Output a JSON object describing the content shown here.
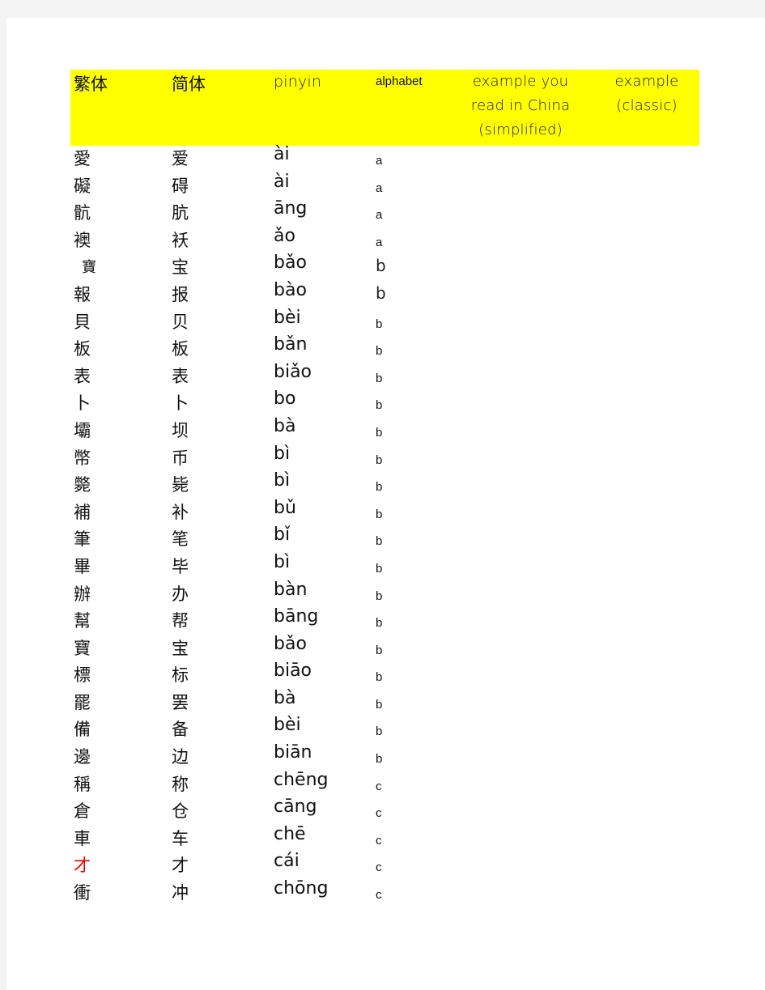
{
  "header": {
    "traditional": "繁体",
    "simplified": "简体",
    "pinyin": "pinyin",
    "alphabet": "alphabet",
    "example_china_line1": "example you",
    "example_china_line2": "read in China",
    "example_china_line3": "(simplified)",
    "example_classic_line1": "example",
    "example_classic_line2": "(classic)"
  },
  "colors": {
    "header_bg": "#ffff00",
    "highlight_text": "#e00000",
    "page_bg": "#ffffff",
    "surround_bg": "#f3f3f3"
  },
  "rows": [
    {
      "traditional": "愛",
      "simplified": "爱",
      "pinyin": "ài",
      "alphabet": "a"
    },
    {
      "traditional": "礙",
      "simplified": "碍",
      "pinyin": "ài",
      "alphabet": "a"
    },
    {
      "traditional": "骯",
      "simplified": "肮",
      "pinyin": "āng",
      "alphabet": "a"
    },
    {
      "traditional": "襖",
      "simplified": "袄",
      "pinyin": "ǎo",
      "alphabet": "a"
    },
    {
      "traditional": "寶",
      "simplified": "宝",
      "pinyin": "bǎo",
      "alphabet": "b"
    },
    {
      "traditional": "報",
      "simplified": "报",
      "pinyin": "bào",
      "alphabet": "b"
    },
    {
      "traditional": "貝",
      "simplified": "贝",
      "pinyin": "bèi",
      "alphabet": "b"
    },
    {
      "traditional": "板",
      "simplified": "板",
      "pinyin": "bǎn",
      "alphabet": "b"
    },
    {
      "traditional": "表",
      "simplified": "表",
      "pinyin": "biǎo",
      "alphabet": "b"
    },
    {
      "traditional": "卜",
      "simplified": "卜",
      "pinyin": "bo",
      "alphabet": "b"
    },
    {
      "traditional": "壩",
      "simplified": "坝",
      "pinyin": "bà",
      "alphabet": "b"
    },
    {
      "traditional": "幣",
      "simplified": "币",
      "pinyin": "bì",
      "alphabet": "b"
    },
    {
      "traditional": "斃",
      "simplified": "毙",
      "pinyin": "bì",
      "alphabet": "b"
    },
    {
      "traditional": "補",
      "simplified": "补",
      "pinyin": "bǔ",
      "alphabet": "b"
    },
    {
      "traditional": "筆",
      "simplified": "笔",
      "pinyin": "bǐ",
      "alphabet": "b"
    },
    {
      "traditional": "畢",
      "simplified": "毕",
      "pinyin": "bì",
      "alphabet": "b"
    },
    {
      "traditional": "辦",
      "simplified": "办",
      "pinyin": "bàn",
      "alphabet": "b"
    },
    {
      "traditional": "幫",
      "simplified": "帮",
      "pinyin": "bāng",
      "alphabet": "b"
    },
    {
      "traditional": "寶",
      "simplified": "宝",
      "pinyin": "bǎo",
      "alphabet": "b"
    },
    {
      "traditional": "標",
      "simplified": "标",
      "pinyin": "biāo",
      "alphabet": "b"
    },
    {
      "traditional": "罷",
      "simplified": "罢",
      "pinyin": "bà",
      "alphabet": "b"
    },
    {
      "traditional": "備",
      "simplified": "备",
      "pinyin": "bèi",
      "alphabet": "b"
    },
    {
      "traditional": "邊",
      "simplified": "边",
      "pinyin": "biān",
      "alphabet": "b"
    },
    {
      "traditional": "稱",
      "simplified": "称",
      "pinyin": "chēng",
      "alphabet": "c"
    },
    {
      "traditional": "倉",
      "simplified": "仓",
      "pinyin": "cāng",
      "alphabet": "c"
    },
    {
      "traditional": "車",
      "simplified": "车",
      "pinyin": "chē",
      "alphabet": "c"
    },
    {
      "traditional": "才",
      "simplified": "才",
      "pinyin": "cái",
      "alphabet": "c",
      "highlight": true
    },
    {
      "traditional": "衝",
      "simplified": "冲",
      "pinyin": "chōng",
      "alphabet": "c"
    }
  ]
}
